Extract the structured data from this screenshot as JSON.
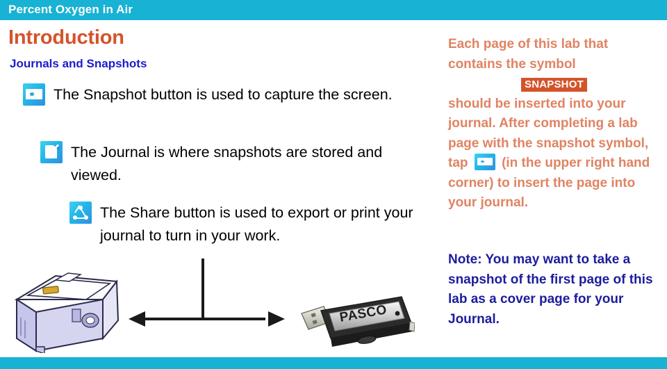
{
  "banner": {
    "title": "Percent Oxygen in Air"
  },
  "headings": {
    "title": "Introduction",
    "subtitle": "Journals and Snapshots"
  },
  "bullets": [
    {
      "icon": "snapshot-camera-icon",
      "text": "The Snapshot button is used to capture the screen."
    },
    {
      "icon": "journal-document-icon",
      "text": "The Journal is where snapshots are stored and viewed."
    },
    {
      "icon": "share-network-icon",
      "text": "The Share button is used to export or print your journal to turn in your work."
    }
  ],
  "right_column": {
    "para_1": "Each page of this lab that contains the symbol",
    "snapshot_badge": "SNAPSHOT",
    "para_2_before_icon": "should be inserted into your journal.  After completing a lab page with the snapshot symbol, tap",
    "para_2_after_icon": "(in the upper right hand corner) to insert the page into your journal.",
    "note_label": "Note:",
    "note_text": " You may want to take a snapshot of the first page of this lab as a cover page for your Journal."
  },
  "illustration": {
    "projector_label": "projector-device-image",
    "usb_label": "PASCO",
    "arrow_label": "double-headed-arrow-diagram"
  },
  "colors": {
    "banner": "#17b2d4",
    "title_orange": "#d4542a",
    "subtitle_blue": "#1c1ccc",
    "right_salmon": "#e08363",
    "note_navy": "#1c1c9e",
    "icon_blue": "#23b6e8"
  }
}
